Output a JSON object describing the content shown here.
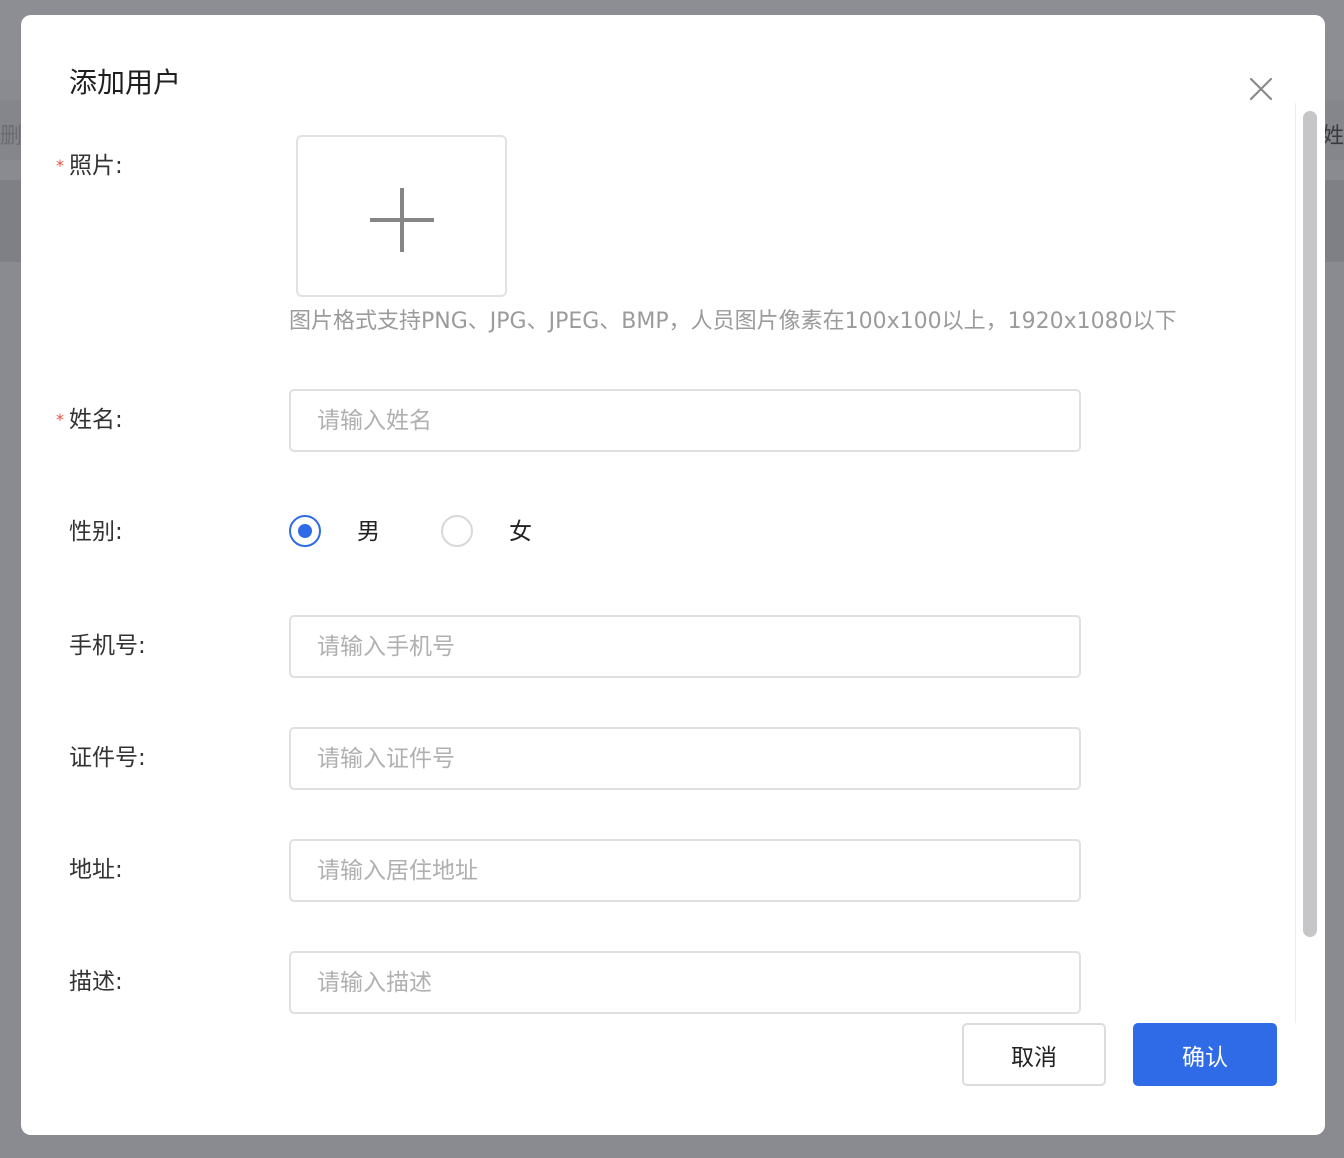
{
  "background": {
    "left_fragment": "删除",
    "right_fragment": "姓"
  },
  "dialog": {
    "title": "添加用户",
    "close_icon": "close-icon"
  },
  "form": {
    "required_mark": "*",
    "photo": {
      "label": "照片:",
      "upload_icon": "plus-icon",
      "hint": "图片格式支持PNG、JPG、JPEG、BMP，人员图片像素在100x100以上，1920x1080以下"
    },
    "name": {
      "label": "姓名:",
      "placeholder": "请输入姓名"
    },
    "gender": {
      "label": "性别:",
      "options": [
        {
          "label": "男",
          "checked": true
        },
        {
          "label": "女",
          "checked": false
        }
      ]
    },
    "phone": {
      "label": "手机号:",
      "placeholder": "请输入手机号"
    },
    "id_number": {
      "label": "证件号:",
      "placeholder": "请输入证件号"
    },
    "address": {
      "label": "地址:",
      "placeholder": "请输入居住地址"
    },
    "description": {
      "label": "描述:",
      "placeholder": "请输入描述"
    }
  },
  "footer": {
    "cancel_label": "取消",
    "confirm_label": "确认"
  },
  "colors": {
    "primary": "#2f6be6",
    "required": "#e5533d",
    "overlay": "#8a8b90"
  }
}
